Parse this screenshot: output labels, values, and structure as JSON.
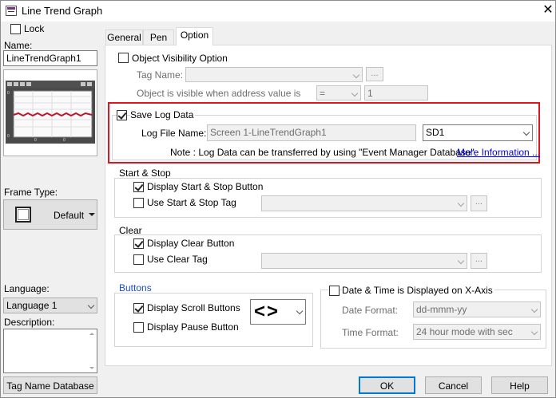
{
  "window": {
    "title": "Line Trend Graph",
    "close_glyph": "✕"
  },
  "left": {
    "lock_label": "Lock",
    "name_label": "Name:",
    "name_value": "LineTrendGraph1",
    "preview_labels": [
      "0",
      "0",
      "0",
      "0"
    ],
    "frame_type_label": "Frame Type:",
    "frame_type_value": "Default",
    "language_label": "Language:",
    "language_value": "Language 1",
    "description_label": "Description:",
    "tag_db_button": "Tag Name Database"
  },
  "tabs": [
    "General",
    "Pen",
    "Option"
  ],
  "option": {
    "visibility_label": "Object Visibility Option",
    "tag_name_label": "Tag Name:",
    "browse_label": "...",
    "visible_when_label": "Object is visible when address value is",
    "operator_value": "=",
    "compare_value": "1",
    "save_log_label": "Save Log Data",
    "log_file_label": "Log File Name:",
    "log_file_value": "Screen 1-LineTrendGraph1",
    "storage_value": "SD1",
    "note_text": "Note : Log Data can be transferred by using \"Event Manager Database\".",
    "more_info_link": "More Information ...",
    "start_stop_group": "Start & Stop",
    "display_start_stop": "Display Start & Stop Button",
    "use_start_stop_tag": "Use Start & Stop Tag",
    "clear_group": "Clear",
    "display_clear": "Display Clear Button",
    "use_clear_tag": "Use Clear Tag",
    "buttons_group": "Buttons",
    "display_scroll": "Display Scroll Buttons",
    "display_pause": "Display Pause Button",
    "scroll_style": "<>",
    "datetime_label": "Date & Time is Displayed on X-Axis",
    "date_format_label": "Date Format:",
    "date_format_value": "dd-mmm-yy",
    "time_format_label": "Time Format:",
    "time_format_value": "24 hour mode with sec"
  },
  "footer": {
    "ok": "OK",
    "cancel": "Cancel",
    "help": "Help"
  },
  "colors": {
    "highlight": "#e0161e",
    "link": "#0000ee",
    "trend_line": "#c0142a",
    "buttons_group_label": "#1f4fbf"
  }
}
